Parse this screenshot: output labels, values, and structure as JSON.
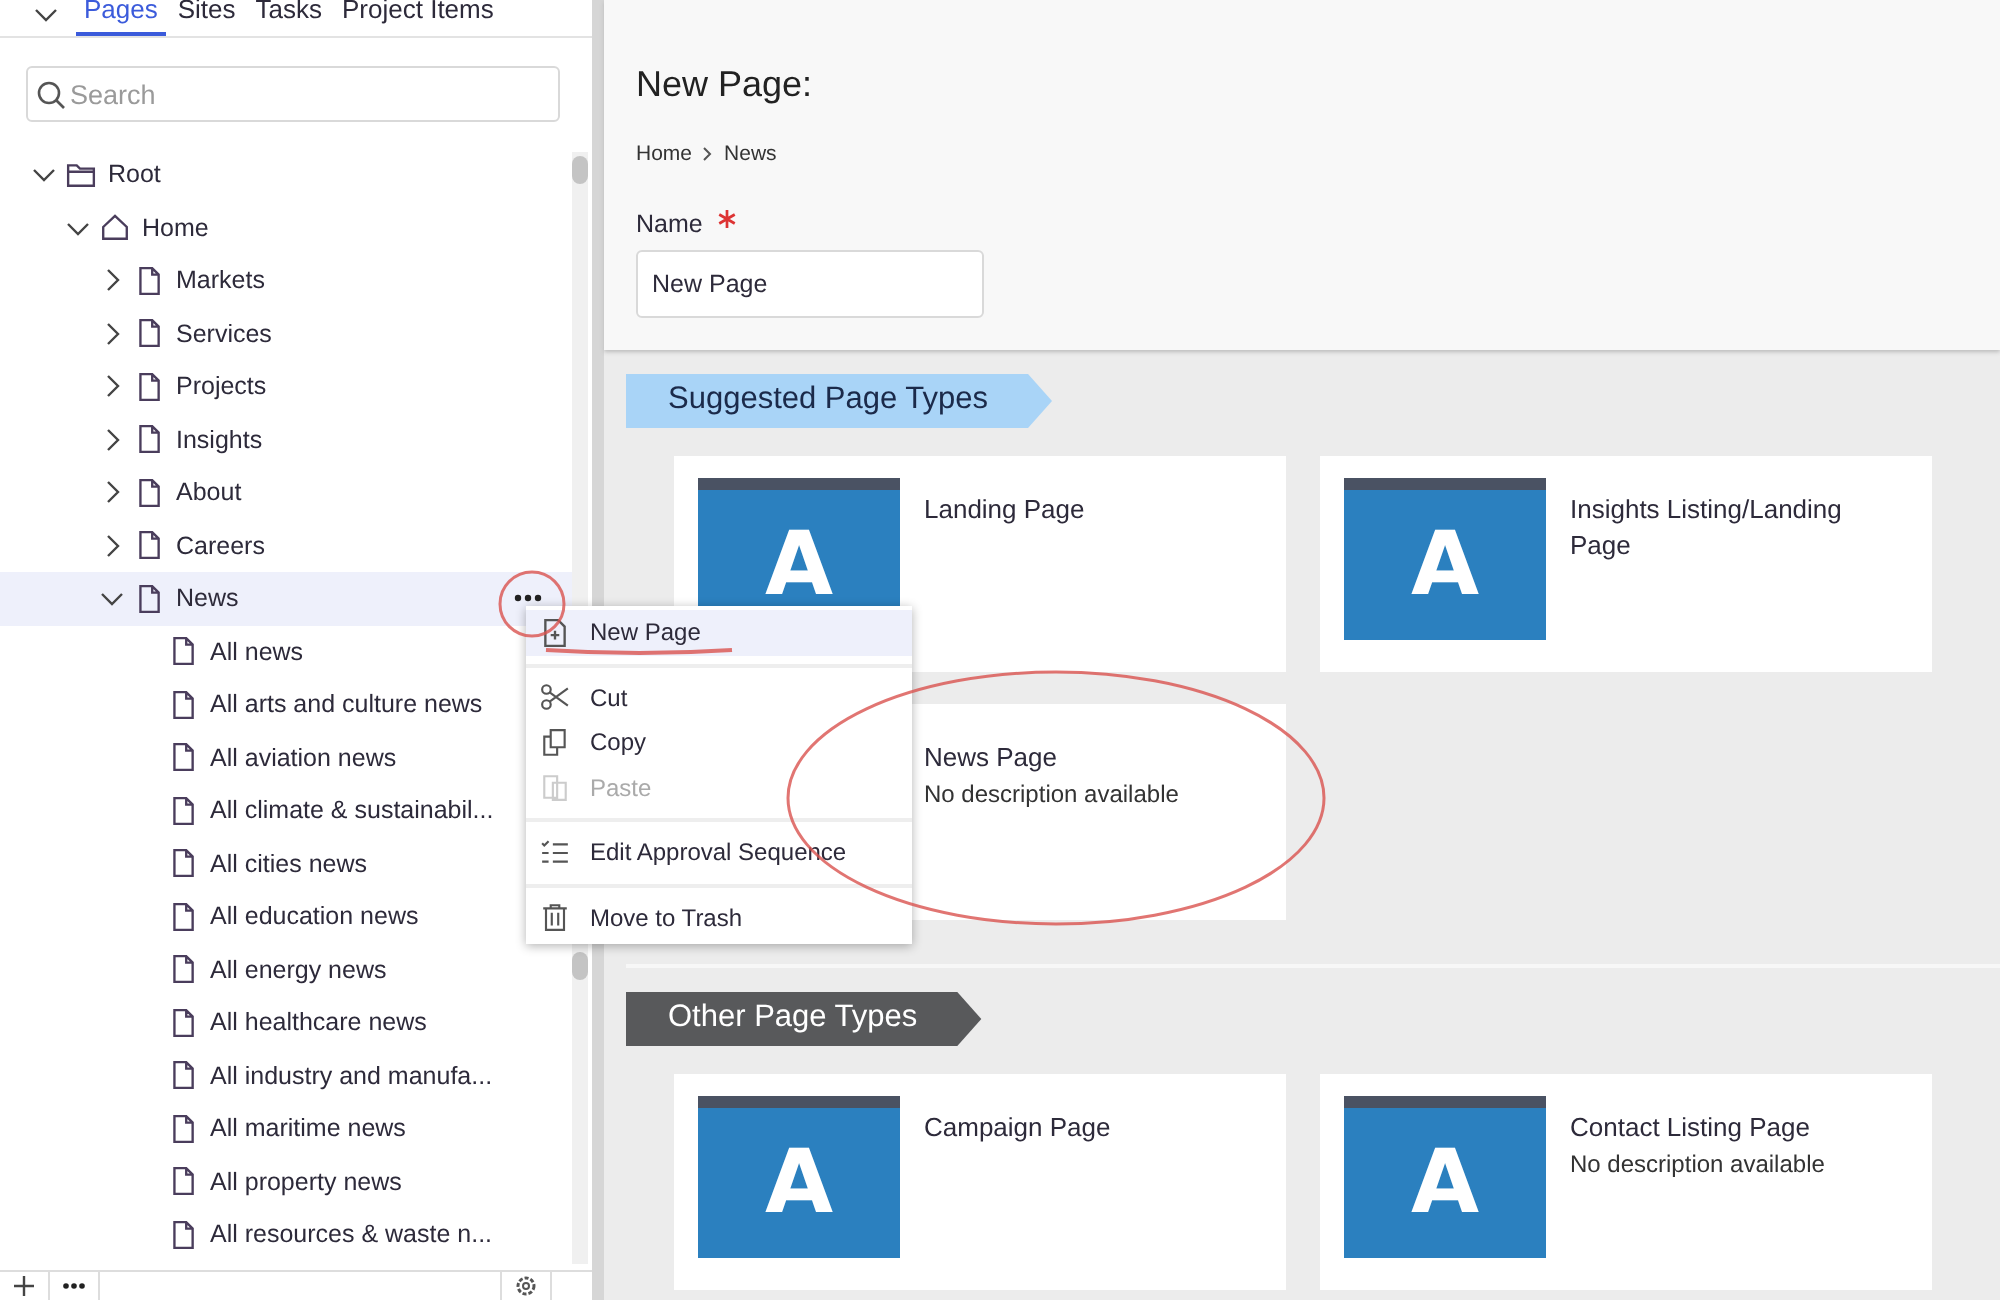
{
  "sidebar": {
    "tabs": [
      {
        "label": "Pages",
        "selected": true
      },
      {
        "label": "Sites",
        "selected": false
      },
      {
        "label": "Tasks",
        "selected": false
      },
      {
        "label": "Project Items",
        "selected": false
      }
    ],
    "search": {
      "placeholder": "Search"
    },
    "tree": [
      {
        "label": "Root",
        "kind": "folder",
        "expanded": true,
        "selected": false,
        "children": [
          {
            "label": "Home",
            "kind": "home",
            "expanded": true,
            "selected": false,
            "children": [
              {
                "label": "Markets",
                "kind": "page",
                "expanded": false,
                "selected": false
              },
              {
                "label": "Services",
                "kind": "page",
                "expanded": false,
                "selected": false
              },
              {
                "label": "Projects",
                "kind": "page",
                "expanded": false,
                "selected": false
              },
              {
                "label": "Insights",
                "kind": "page",
                "expanded": false,
                "selected": false
              },
              {
                "label": "About",
                "kind": "page",
                "expanded": false,
                "selected": false
              },
              {
                "label": "Careers",
                "kind": "page",
                "expanded": false,
                "selected": false
              },
              {
                "label": "News",
                "kind": "page",
                "expanded": true,
                "selected": true,
                "children": [
                  {
                    "label": "All news",
                    "kind": "leaf",
                    "selected": false
                  },
                  {
                    "label": "All arts and culture news",
                    "kind": "leaf",
                    "selected": false
                  },
                  {
                    "label": "All aviation news",
                    "kind": "leaf",
                    "selected": false
                  },
                  {
                    "label": "All climate & sustainabil...",
                    "kind": "leaf",
                    "selected": false
                  },
                  {
                    "label": "All cities news",
                    "kind": "leaf",
                    "selected": false
                  },
                  {
                    "label": "All education news",
                    "kind": "leaf",
                    "selected": false
                  },
                  {
                    "label": "All energy news",
                    "kind": "leaf",
                    "selected": false
                  },
                  {
                    "label": "All healthcare news",
                    "kind": "leaf",
                    "selected": false
                  },
                  {
                    "label": "All industry and manufa...",
                    "kind": "leaf",
                    "selected": false
                  },
                  {
                    "label": "All maritime news",
                    "kind": "leaf",
                    "selected": false
                  },
                  {
                    "label": "All property news",
                    "kind": "leaf",
                    "selected": false
                  },
                  {
                    "label": "All resources & waste n...",
                    "kind": "leaf",
                    "selected": false
                  }
                ]
              }
            ]
          }
        ]
      }
    ]
  },
  "context_menu": {
    "groups": [
      [
        {
          "label": "New Page",
          "kind": "new",
          "selected": true,
          "disabled": false
        }
      ],
      [
        {
          "label": "Cut",
          "kind": "cut",
          "selected": false,
          "disabled": false
        },
        {
          "label": "Copy",
          "kind": "copy",
          "selected": false,
          "disabled": false
        },
        {
          "label": "Paste",
          "kind": "paste",
          "selected": false,
          "disabled": true
        }
      ],
      [
        {
          "label": "Edit Approval Sequence",
          "kind": "approval",
          "selected": false,
          "disabled": false
        }
      ],
      [
        {
          "label": "Move to Trash",
          "kind": "trash",
          "selected": false,
          "disabled": false
        }
      ]
    ]
  },
  "main": {
    "title": "New Page:",
    "breadcrumb": [
      "Home",
      "News"
    ],
    "name_field": {
      "label": "Name",
      "required": true,
      "value": "New Page"
    },
    "sections": [
      {
        "title": "Suggested Page Types",
        "kind": "suggested",
        "cards": [
          {
            "title": "Landing Page",
            "thumbnail_letter": "A"
          },
          {
            "title": "Insights Listing/Landing Page",
            "thumbnail_letter": "A"
          },
          {
            "title": "News Page",
            "description": "No description available"
          }
        ]
      },
      {
        "title": "Other Page Types",
        "kind": "other",
        "cards": [
          {
            "title": "Campaign Page",
            "thumbnail_letter": "A"
          },
          {
            "title": "Contact Listing Page",
            "thumbnail_letter": "A",
            "description": "No description available"
          }
        ]
      }
    ]
  }
}
